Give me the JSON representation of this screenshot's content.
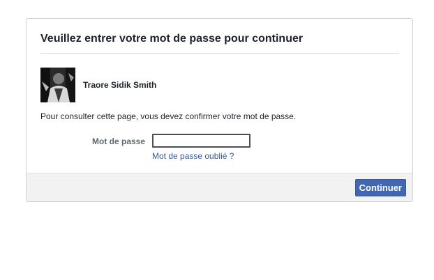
{
  "dialog": {
    "title": "Veuillez entrer votre mot de passe pour continuer"
  },
  "user": {
    "name": "Traore Sidik Smith",
    "avatar_icon": "user-photo"
  },
  "instructions": "Pour consulter cette page, vous devez confirmer votre mot de passe.",
  "password": {
    "label": "Mot de passe",
    "value": "",
    "forgot_link": "Mot de passe oublié ?"
  },
  "footer": {
    "continue_label": "Continuer"
  },
  "colors": {
    "link": "#385898",
    "button": "#4267b2",
    "footer_bg": "#f2f2f2"
  }
}
